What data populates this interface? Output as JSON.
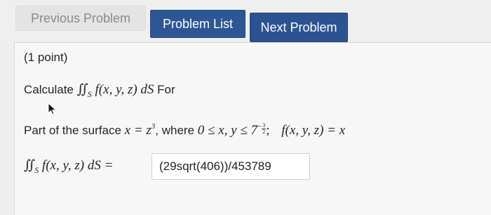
{
  "nav": {
    "previous_label": "Previous Problem",
    "list_label": "Problem List",
    "next_label": "Next Problem"
  },
  "problem": {
    "points": "(1 point)",
    "calculate_word": "Calculate",
    "integral_sign": "∬",
    "integral_sub": "S",
    "integrand": "f(x, y, z) dS",
    "for_word": "For",
    "part_prefix": "Part of the surface",
    "surface_eq_lhs": "x = z",
    "surface_exp": "3",
    "where_word": ", where",
    "domain_expr": "0 ≤ x, y ≤ 7",
    "domain_exp_sign": "−",
    "domain_exp_num": "3",
    "domain_exp_den": "2",
    "separator": ";",
    "function_def": "f(x, y, z) = x",
    "answer_lhs": "f(x, y, z) dS =",
    "answer_value": "(29sqrt(406))/453789"
  },
  "colors": {
    "primary_button": "#2d5694",
    "disabled_button_text": "#8a8a8a",
    "panel_bg": "#f7f7f7"
  }
}
